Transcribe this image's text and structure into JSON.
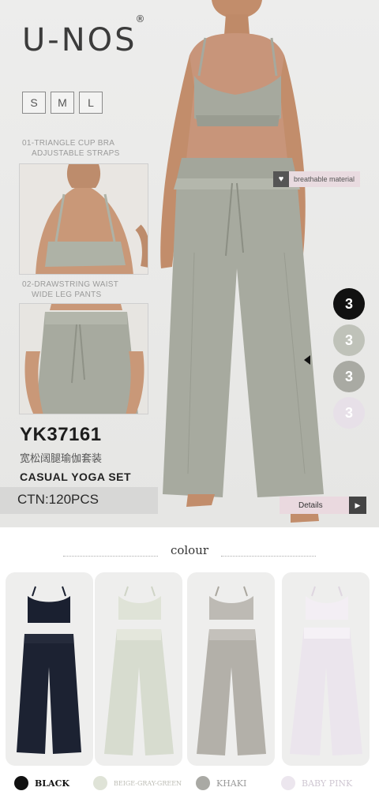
{
  "brand": {
    "logo": "U-NOS",
    "registered": "®"
  },
  "sizes": [
    "S",
    "M",
    "L"
  ],
  "captions": {
    "bra_1": "01-TRIANGLE CUP BRA",
    "bra_2": "ADJUSTABLE STRAPS",
    "pants_1": "02-DRAWSTRING WAIST",
    "pants_2": "WIDE LEG PANTS"
  },
  "tag": {
    "label": "breathable material"
  },
  "color_counts": [
    "3",
    "3",
    "3",
    "3"
  ],
  "product": {
    "code": "YK37161",
    "chinese_name": "宽松阔腿瑜伽套装",
    "name": "CASUAL YOGA SET",
    "ctn": "CTN:120PCS"
  },
  "details": {
    "label": "Details",
    "arrow": "▶"
  },
  "colour_section": {
    "title": "colour",
    "options": [
      {
        "name": "BLACK",
        "color": "#1a2030"
      },
      {
        "name": "BEIGE-GRAY-GREEN",
        "color": "#dfe3d7"
      },
      {
        "name": "KHAKI",
        "color": "#bdbab4"
      },
      {
        "name": "BABY PINK",
        "color": "#ece6ee"
      }
    ]
  },
  "circle_colors": [
    "#111111",
    "#bfc2b9",
    "#a9aaa3",
    "#e7e0e8"
  ]
}
